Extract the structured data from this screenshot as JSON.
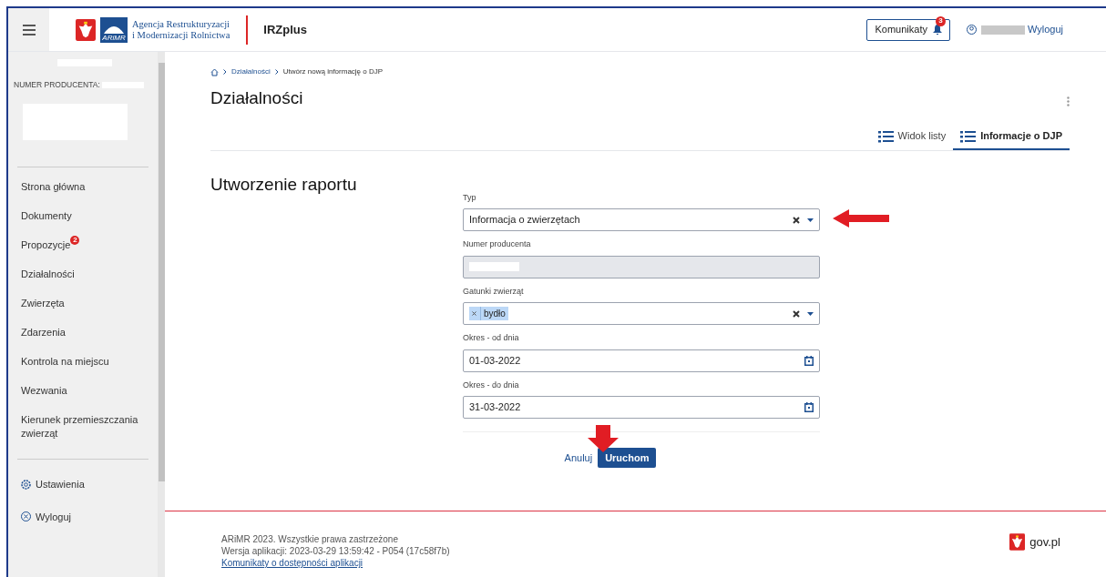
{
  "header": {
    "org_name": [
      "Agencja Restrukturyzacji",
      "i Modernizacji Rolnictwa"
    ],
    "logo_text": "ARiMR",
    "app_name": "IRZplus",
    "notifications": {
      "label": "Komunikaty",
      "count": "3"
    },
    "logout": "Wyloguj"
  },
  "sidebar": {
    "producer_label": "NUMER PRODUCENTA:",
    "nav": [
      {
        "label": "Strona główna"
      },
      {
        "label": "Dokumenty"
      },
      {
        "label": "Propozycje",
        "badge": "2"
      },
      {
        "label": "Działalności"
      },
      {
        "label": "Zwierzęta"
      },
      {
        "label": "Zdarzenia"
      },
      {
        "label": "Kontrola na miejscu"
      },
      {
        "label": "Wezwania"
      },
      {
        "label": "Kierunek przemieszczania zwierząt"
      }
    ],
    "bottom": [
      {
        "kind": "settings",
        "label": "Ustawienia"
      },
      {
        "kind": "logout",
        "label": "Wyloguj"
      }
    ]
  },
  "breadcrumb": [
    "Działalności",
    "Utwórz nową informację o DJP"
  ],
  "page_title": "Działalności",
  "tabs": [
    {
      "label": "Widok listy",
      "selected": false
    },
    {
      "label": "Informacje o DJP",
      "selected": true
    }
  ],
  "form": {
    "title": "Utworzenie raportu",
    "fields": [
      {
        "kind": "select",
        "label": "Typ",
        "value": "Informacja o zwierzętach",
        "pointer": true
      },
      {
        "kind": "readonly",
        "label": "Numer producenta"
      },
      {
        "kind": "multiselect",
        "label": "Gatunki zwierząt",
        "tags": [
          "bydło"
        ]
      },
      {
        "kind": "date",
        "label": "Okres - od dnia",
        "value": "01-03-2022"
      },
      {
        "kind": "date",
        "label": "Okres - do dnia",
        "value": "31-03-2022"
      }
    ],
    "cancel": "Anuluj",
    "submit": "Uruchom"
  },
  "footer": {
    "lines": [
      "ARiMR 2023. Wszystkie prawa zastrzeżone",
      "Wersja aplikacji: 2023-03-29 13:59:42 - P054 (17c58f7b)"
    ],
    "link": "Komunikaty o dostępności aplikacji",
    "gov": "gov.pl"
  }
}
